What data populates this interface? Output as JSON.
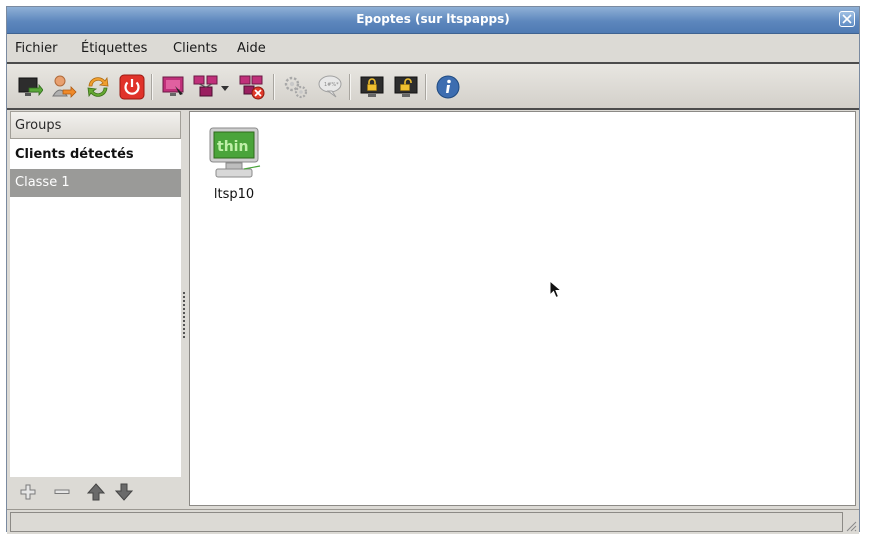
{
  "window": {
    "title": "Epoptes (sur ltspapps)"
  },
  "menubar": {
    "items": [
      "Fichier",
      "Étiquettes",
      "Clients",
      "Aide"
    ]
  },
  "toolbar": {
    "buttons": [
      {
        "icon": "monitor-arrow-icon"
      },
      {
        "icon": "user-logout-icon"
      },
      {
        "icon": "reboot-icon"
      },
      {
        "icon": "power-icon"
      },
      {
        "icon": "observe-client-icon"
      },
      {
        "icon": "broadcast-screen-icon"
      },
      {
        "icon": "dropdown-arrow-icon"
      },
      {
        "icon": "stop-broadcast-icon"
      },
      {
        "icon": "execute-command-icon"
      },
      {
        "icon": "send-message-icon"
      },
      {
        "icon": "lock-screen-icon"
      },
      {
        "icon": "unlock-screen-icon"
      },
      {
        "icon": "info-icon"
      }
    ]
  },
  "sidebar": {
    "header": "Groups",
    "items": [
      {
        "label": "Clients détectés",
        "bold": true
      },
      {
        "label": "Classe 1",
        "selected": true
      }
    ]
  },
  "clients": [
    {
      "name": "ltsp10",
      "screen_text": "thin",
      "screen_color": "#4aa43a"
    }
  ],
  "colors": {
    "titlebar": "#5d87bd",
    "selected_row": "#9a9a98",
    "power": "#e0332a",
    "reboot": "#66a833",
    "info": "#3d6db0"
  }
}
